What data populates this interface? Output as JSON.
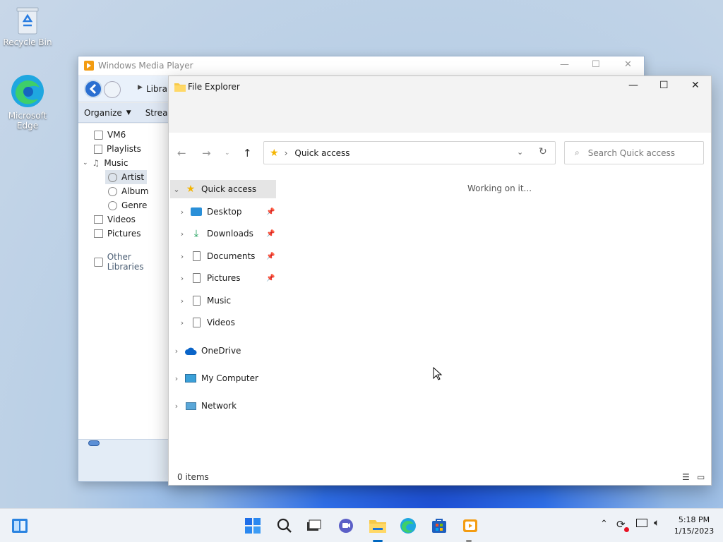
{
  "desktop": {
    "icons": [
      {
        "label": "Recycle Bin"
      },
      {
        "label_line1": "Microsoft",
        "label_line2": "Edge"
      }
    ]
  },
  "wmp": {
    "title": "Windows Media Player",
    "breadcrumb": "Libra",
    "toolbar": {
      "organize": "Organize",
      "stream": "Stream"
    },
    "tree": [
      "VM6",
      "Playlists",
      "Music",
      "Artist",
      "Album",
      "Genre",
      "Videos",
      "Pictures",
      "Other Libraries"
    ]
  },
  "explorer": {
    "title": "File Explorer",
    "address": "Quick access",
    "search_placeholder": "Search Quick access",
    "working_text": "Working on it...",
    "nav": {
      "quick_access": "Quick access",
      "pinned": [
        "Desktop",
        "Downloads",
        "Documents",
        "Pictures"
      ],
      "other": [
        "Music",
        "Videos"
      ],
      "onedrive": "OneDrive",
      "computer": "My Computer",
      "network": "Network"
    },
    "status": "0 items"
  },
  "taskbar": {
    "time": "5:18 PM",
    "date": "1/15/2023"
  },
  "colors": {
    "accent": "#0067c0",
    "folder": "#f7c948",
    "selection": "#e5e5e5"
  }
}
